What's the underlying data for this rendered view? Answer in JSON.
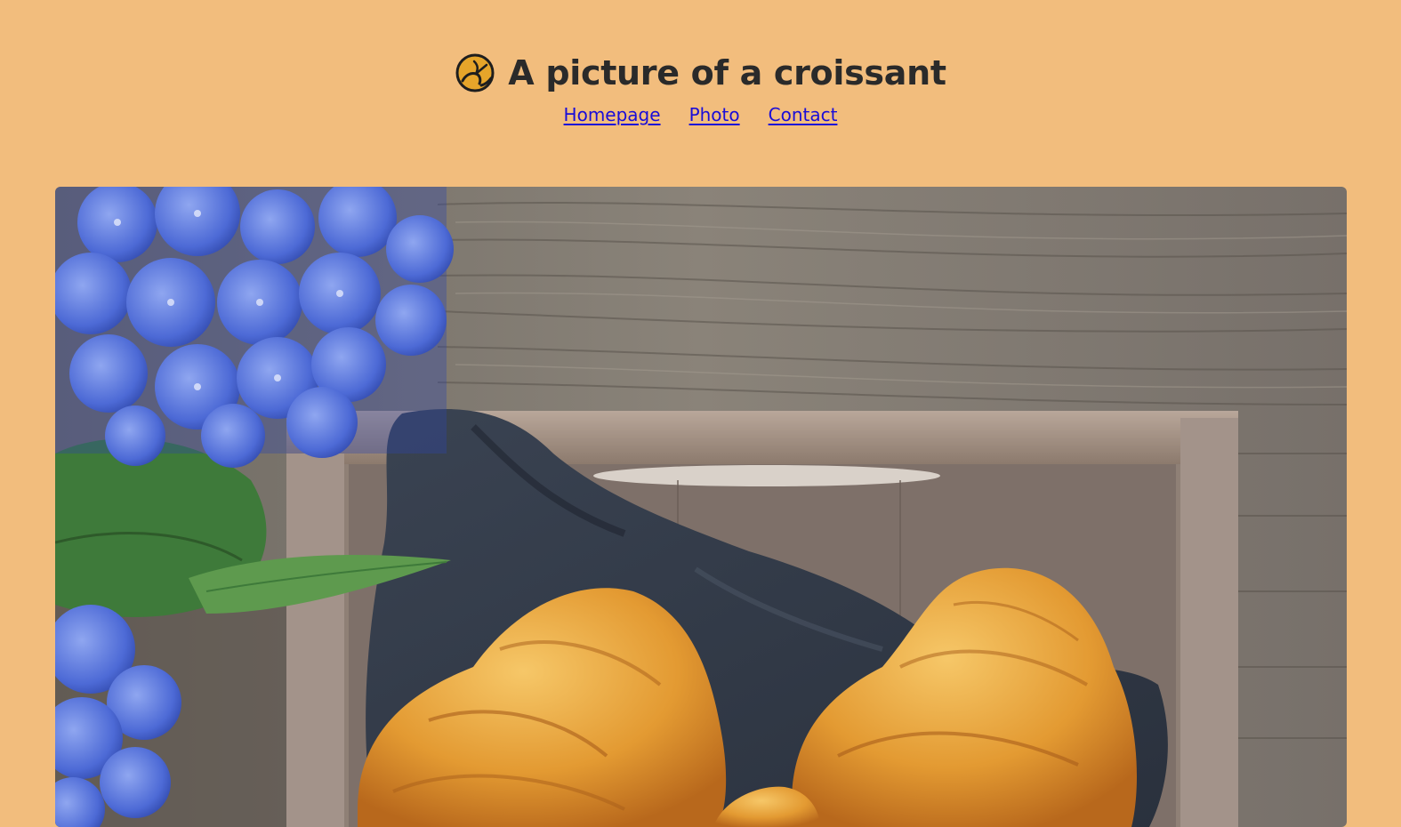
{
  "header": {
    "logo_icon": "croissant-icon",
    "title": "A picture of a croissant"
  },
  "nav": {
    "items": [
      {
        "label": "Homepage"
      },
      {
        "label": "Photo"
      },
      {
        "label": "Contact"
      }
    ]
  },
  "photo": {
    "alt": "A picture of a croissant",
    "subjects": [
      "blue hydrangea flowers",
      "green leaves",
      "wooden tray",
      "dark blue napkin",
      "croissants",
      "wooden table"
    ]
  },
  "colors": {
    "background": "#F2BD7D",
    "title": "#2A2A2A",
    "link": "#1A0DD8",
    "logo_fill": "#E6A52A",
    "logo_stroke": "#1E1E1E"
  }
}
